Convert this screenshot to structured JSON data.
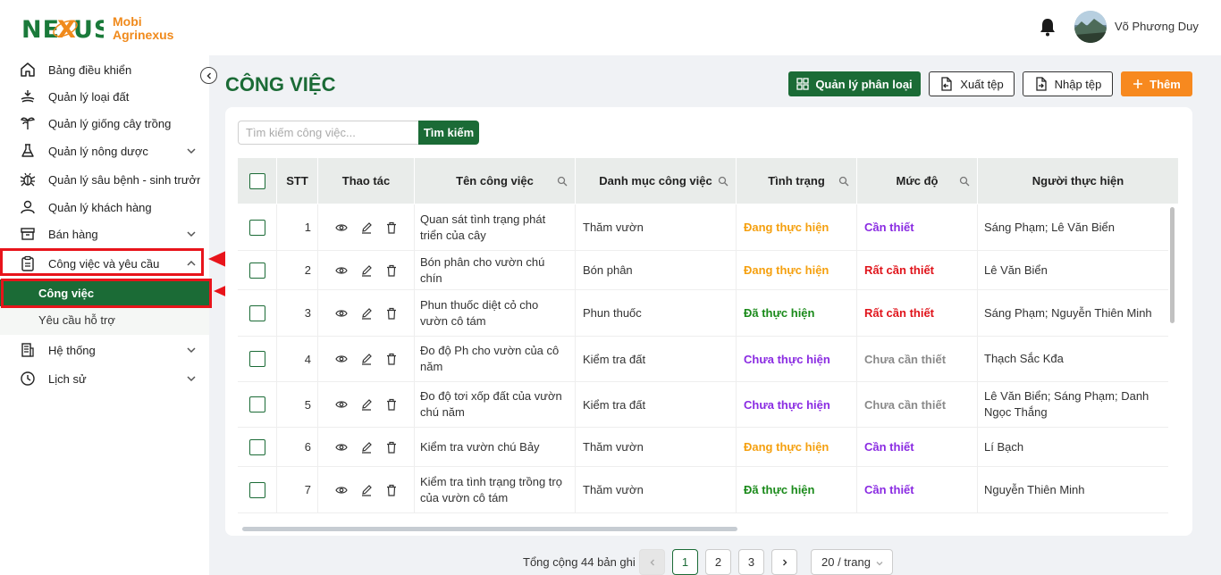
{
  "brand": {
    "mark": "NEXUS",
    "name_line1": "Mobi",
    "name_line2": "Agrinexus"
  },
  "user": {
    "name": "Võ Phương Duy"
  },
  "sidebar": {
    "items": [
      {
        "label": "Bảng điều khiển"
      },
      {
        "label": "Quản lý loại đất"
      },
      {
        "label": "Quản lý giống cây trồng"
      },
      {
        "label": "Quản lý nông dược"
      },
      {
        "label": "Quản lý sâu bệnh - sinh trưởng"
      },
      {
        "label": "Quản lý khách hàng"
      },
      {
        "label": "Bán hàng"
      },
      {
        "label": "Công việc và yêu cầu"
      },
      {
        "label": "Hệ thống"
      },
      {
        "label": "Lịch sử"
      }
    ],
    "sub_items": [
      {
        "label": "Công việc",
        "active": true
      },
      {
        "label": "Yêu cầu hỗ trợ",
        "active": false
      }
    ]
  },
  "page": {
    "title": "CÔNG VIỆC"
  },
  "toolbar": {
    "manage_categories": "Quản lý phân loại",
    "export": "Xuất tệp",
    "import": "Nhập tệp",
    "add": "Thêm"
  },
  "search": {
    "placeholder": "Tìm kiếm công việc...",
    "button": "Tìm kiếm"
  },
  "table": {
    "headers": {
      "stt": "STT",
      "actions": "Thao tác",
      "name": "Tên công việc",
      "category": "Danh mục công việc",
      "status": "Tình trạng",
      "level": "Mức độ",
      "assignee": "Người thực hiện"
    },
    "rows": [
      {
        "stt": "1",
        "name": "Quan sát tình trạng phát triển của cây",
        "category": "Thăm vườn",
        "status": "Đang thực hiện",
        "level": "Cần thiết",
        "assignee": "Sáng Phạm; Lê  Văn Biển"
      },
      {
        "stt": "2",
        "name": "Bón phân cho vườn chú chín",
        "category": "Bón phân",
        "status": "Đang thực hiện",
        "level": "Rất cần thiết",
        "assignee": "Lê  Văn Biển"
      },
      {
        "stt": "3",
        "name": "Phun thuốc diệt cỏ cho vườn cô tám",
        "category": "Phun thuốc",
        "status": "Đã thực hiện",
        "level": "Rất cần thiết",
        "assignee": "Sáng Phạm; Nguyễn  Thiên Minh"
      },
      {
        "stt": "4",
        "name": "Đo độ Ph cho vườn của cô năm",
        "category": "Kiểm tra đất",
        "status": "Chưa thực hiện",
        "level": "Chưa cần thiết",
        "assignee": "Thạch Sắc Kđa"
      },
      {
        "stt": "5",
        "name": "Đo độ tơi xốp đất của vườn chú năm",
        "category": "Kiểm tra đất",
        "status": "Chưa thực hiện",
        "level": "Chưa cần thiết",
        "assignee": "Lê  Văn Biển; Sáng Phạm; Danh  Ngọc Thắng"
      },
      {
        "stt": "6",
        "name": "Kiểm tra vườn chú Bảy",
        "category": "Thăm vườn",
        "status": "Đang thực hiện",
        "level": "Cần thiết",
        "assignee": "Lí  Bạch"
      },
      {
        "stt": "7",
        "name": "Kiểm tra tình trạng trồng trọ của vườn cô tám",
        "category": "Thăm vườn",
        "status": "Đã thực hiện",
        "level": "Cần thiết",
        "assignee": "Nguyễn  Thiên Minh"
      }
    ]
  },
  "pagination": {
    "total_text": "Tổng cộng 44 bản ghi",
    "pages": [
      "1",
      "2",
      "3"
    ],
    "current": "1",
    "page_size": "20 / trang"
  }
}
